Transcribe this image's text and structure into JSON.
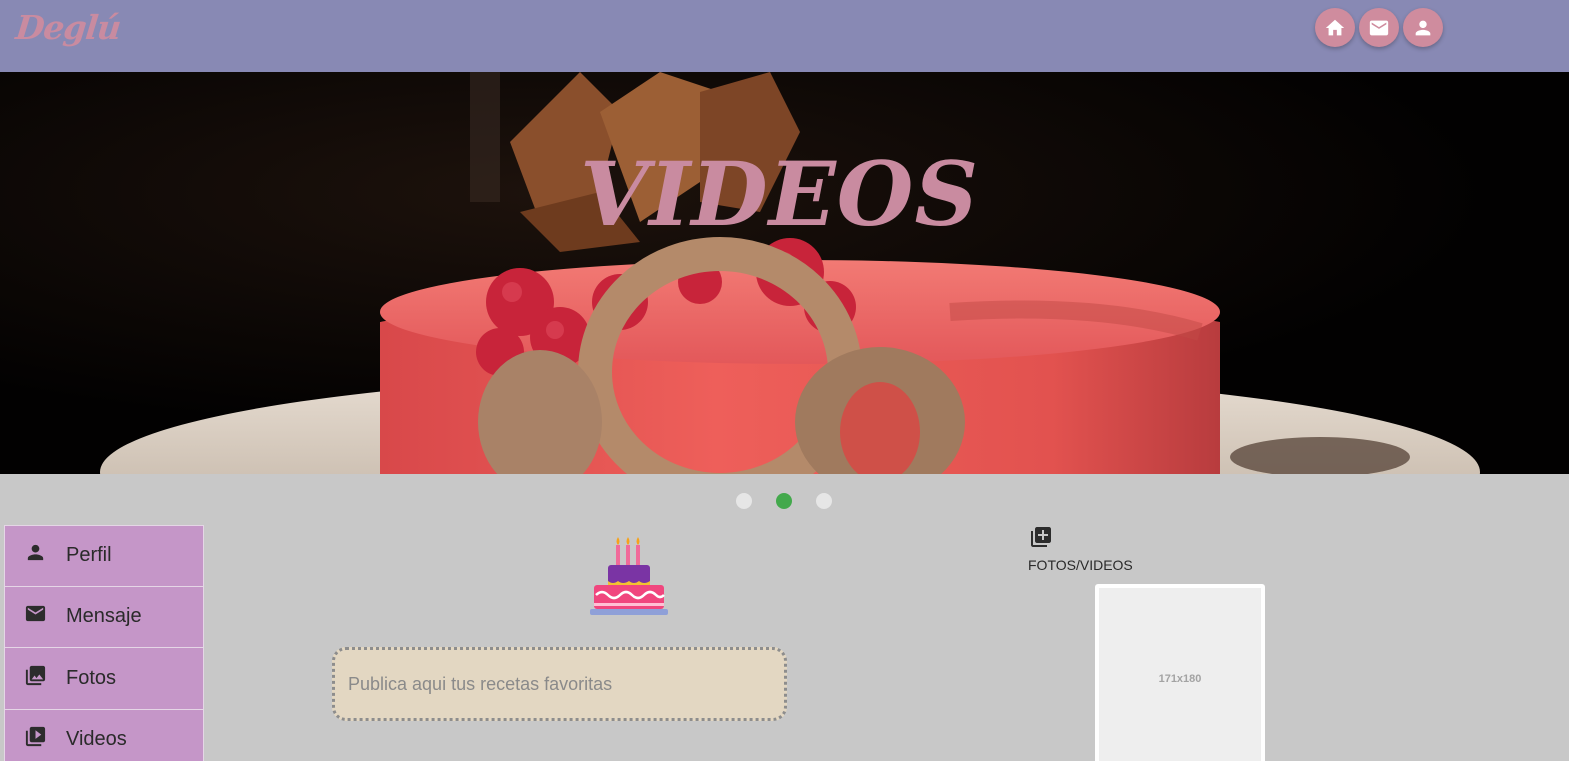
{
  "app": {
    "logo": "Deglú"
  },
  "header_nav": [
    {
      "name": "home-button",
      "icon": "home-icon"
    },
    {
      "name": "messages-button",
      "icon": "mail-icon"
    },
    {
      "name": "profile-button",
      "icon": "person-icon"
    }
  ],
  "hero": {
    "title": "VIDEOS"
  },
  "carousel": {
    "slide_count": 3,
    "active_index": 1,
    "active_color": "#43a94c",
    "inactive_color": "#e6e6e6"
  },
  "sidebar": {
    "items": [
      {
        "label": "Perfil",
        "icon": "person-icon"
      },
      {
        "label": "Mensaje",
        "icon": "mail-icon"
      },
      {
        "label": "Fotos",
        "icon": "photo-library-icon"
      },
      {
        "label": "Videos",
        "icon": "video-library-icon"
      }
    ]
  },
  "composer": {
    "placeholder": "Publica aqui tus recetas favoritas",
    "value": ""
  },
  "media_panel": {
    "icon": "add-to-photos-icon",
    "label": "FOTOS/VIDEOS",
    "thumbnail_text": "171x180"
  },
  "colors": {
    "topbar": "#8889b4",
    "accent_pink": "#cf8c9e",
    "sidebar": "#c596c8",
    "background": "#c8c8c8",
    "composer": "#e3d7c2"
  }
}
